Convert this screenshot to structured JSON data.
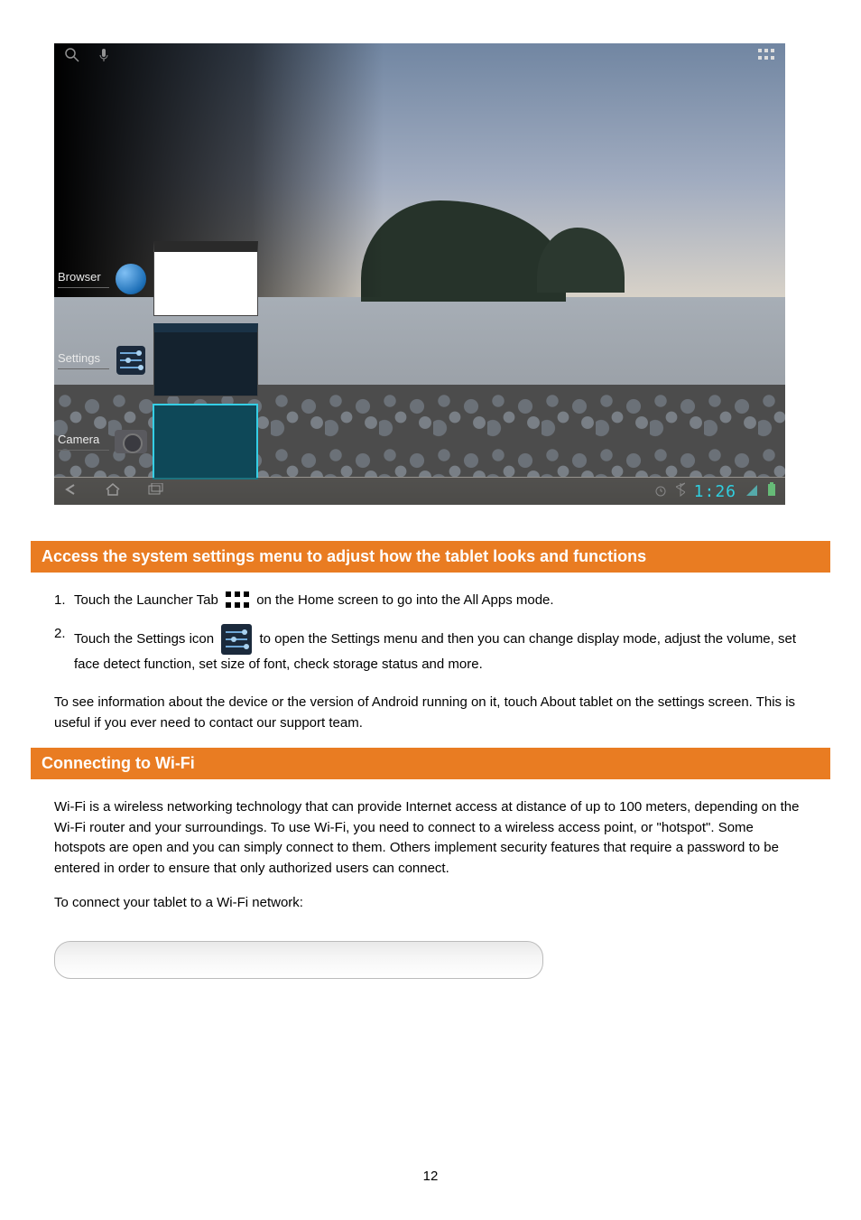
{
  "page_number": "12",
  "screenshot": {
    "topbar": {
      "search_icon": "search-icon",
      "mic_icon": "mic-icon",
      "apps_icon": "apps-grid-icon"
    },
    "recent_apps": [
      {
        "label": "Browser",
        "icon": "globe-icon",
        "thumb": "browser"
      },
      {
        "label": "Settings",
        "icon": "sliders-icon",
        "thumb": "settings"
      },
      {
        "label": "Camera",
        "icon": "camera-icon",
        "thumb": "camera"
      }
    ],
    "navbar": {
      "back_icon": "back-icon",
      "home_icon": "home-icon",
      "recent_icon": "recent-icon",
      "alarm_icon": "alarm-icon",
      "bt_icon": "bluetooth-icon",
      "clock": "1:26",
      "signal_icon": "signal-icon",
      "battery_icon": "battery-icon"
    }
  },
  "section_settings": {
    "header": "Access the system settings menu to adjust how the tablet looks and functions",
    "steps": [
      {
        "pre": "Touch the Launcher Tab  ",
        "post": " on the Home screen to go into the All Apps mode."
      },
      {
        "pre": "Touch the Settings icon ",
        "post": " to open the Settings menu and then you can change display mode, adjust the volume, set face detect function, set size of font, check storage status and more."
      }
    ],
    "paragraph": "To see information about the device or the version of Android running on it, touch About tablet on the settings screen. This is useful if you ever need to contact our support team."
  },
  "section_wifi": {
    "header": "Connecting to Wi-Fi",
    "intro": "Wi-Fi is a wireless networking technology that can provide Internet access at distance of up to 100 meters, depending on the Wi-Fi router and your surroundings. To use Wi-Fi, you need to connect to a wireless access point, or \"hotspot\". Some hotspots are open and you can simply connect to them. Others implement security features that require a password to be entered in order to ensure that only authorized users can connect.",
    "list_lead": "To connect your tablet to a Wi-Fi network:"
  },
  "icons": {
    "apps_grid": "apps-grid-icon",
    "settings": "settings-icon"
  }
}
